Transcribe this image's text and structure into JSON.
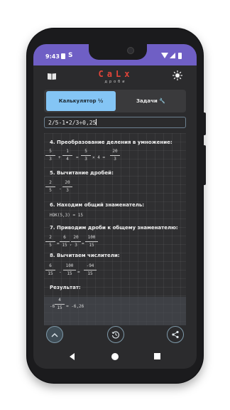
{
  "status_bar": {
    "time": "9:43",
    "sim_icon": "S"
  },
  "app": {
    "title": "CaLx",
    "subtitle": "дроби"
  },
  "tabs": [
    {
      "label": "Калькулятор ½",
      "selected": true
    },
    {
      "label": "Задачи 🔧",
      "selected": false
    }
  ],
  "input": {
    "expression": "2/5-1•2/3÷0,25"
  },
  "steps": {
    "s4": {
      "title": "4. Преобразование деления в умножение:",
      "f1": {
        "n": "5",
        "d": "3"
      },
      "op1": "+",
      "f2": {
        "n": "1",
        "d": "4"
      },
      "op2": "=",
      "f3": {
        "n": "5",
        "d": "3"
      },
      "op3": "× 4 =",
      "f4": {
        "n": "20",
        "d": "3"
      }
    },
    "s5": {
      "title": "5. Вычитание дробей:",
      "f1": {
        "n": "2",
        "d": "5"
      },
      "op1": "-",
      "f2": {
        "n": "20",
        "d": "3"
      }
    },
    "s6": {
      "title": "6. Находим общий знаменатель:",
      "line": "НОК(5,3) = 15"
    },
    "s7": {
      "title": "7. Приводим дроби к общему знаменателю:",
      "f1": {
        "n": "2",
        "d": "5"
      },
      "op1": "=",
      "f2": {
        "n": "6",
        "d": "15"
      },
      "op2": ",",
      "f3": {
        "n": "20",
        "d": "3"
      },
      "op3": "=",
      "f4": {
        "n": "100",
        "d": "15"
      }
    },
    "s8": {
      "title": "8. Вычитаем числители:",
      "f1": {
        "n": "6",
        "d": "15"
      },
      "op1": "-",
      "f2": {
        "n": "100",
        "d": "15"
      },
      "op2": "=",
      "f3": {
        "n": "-94",
        "d": "15"
      }
    }
  },
  "result": {
    "title": "Результат:",
    "whole": "-6",
    "numerator": "4",
    "denominator": "15",
    "decimal_text": "≈ -6,26"
  },
  "bottom_bar": {
    "up_icon": "chevron-up-icon",
    "history_icon": "history-icon",
    "share_icon": "share-icon"
  },
  "colors": {
    "status_bar": "#6f5fc5",
    "accent_tab": "#84c5f5",
    "brand": "#e4453a",
    "background": "#2b2b2d"
  }
}
